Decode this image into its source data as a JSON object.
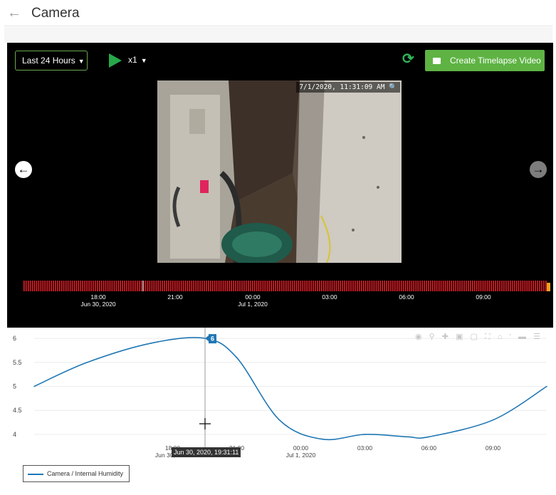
{
  "header": {
    "back_icon": "back-arrow-icon",
    "title": "Camera"
  },
  "player": {
    "range_label": "Last 24 Hours",
    "speed_label": "x1",
    "timelapse_label": "Create Timelapse Video",
    "frame_timestamp": "7/1/2020, 11:31:09 AM",
    "accent_color": "#5eb343",
    "timeline": {
      "tick_color": "#e8212a",
      "labels": [
        {
          "time": "18:00",
          "date": "Jun 30, 2020"
        },
        {
          "time": "21:00",
          "date": ""
        },
        {
          "time": "00:00",
          "date": "Jul 1, 2020"
        },
        {
          "time": "03:00",
          "date": ""
        },
        {
          "time": "06:00",
          "date": ""
        },
        {
          "time": "09:00",
          "date": ""
        }
      ]
    }
  },
  "chart_data": {
    "type": "line",
    "title": "",
    "xlabel": "",
    "ylabel": "",
    "ylim": [
      3.85,
      6.15
    ],
    "yticks": [
      "6",
      "5.5",
      "5",
      "4.5",
      "4"
    ],
    "x_tick_labels": [
      {
        "time": "18:00",
        "date": "Jun 30, 2020"
      },
      {
        "time": "21:00",
        "date": ""
      },
      {
        "time": "00:00",
        "date": "Jul 1, 2020"
      },
      {
        "time": "03:00",
        "date": ""
      },
      {
        "time": "06:00",
        "date": ""
      },
      {
        "time": "09:00",
        "date": ""
      }
    ],
    "series": [
      {
        "name": "Camera / Internal Humidity",
        "color": "#1f77b4",
        "x": [
          "2020-06-30 11:31",
          "2020-06-30 14:00",
          "2020-06-30 17:00",
          "2020-06-30 19:31",
          "2020-06-30 21:00",
          "2020-06-30 23:00",
          "2020-07-01 01:00",
          "2020-07-01 03:00",
          "2020-07-01 05:00",
          "2020-07-01 06:00",
          "2020-07-01 09:00",
          "2020-07-01 11:31"
        ],
        "y": [
          5.0,
          5.5,
          5.9,
          6.0,
          5.6,
          4.3,
          3.9,
          4.0,
          3.95,
          3.95,
          4.3,
          5.0
        ]
      }
    ],
    "hover": {
      "value_label": "6",
      "x_label": "Jun 30, 2020, 19:31:11"
    },
    "grid": true,
    "legend_position": "bottom-left"
  }
}
